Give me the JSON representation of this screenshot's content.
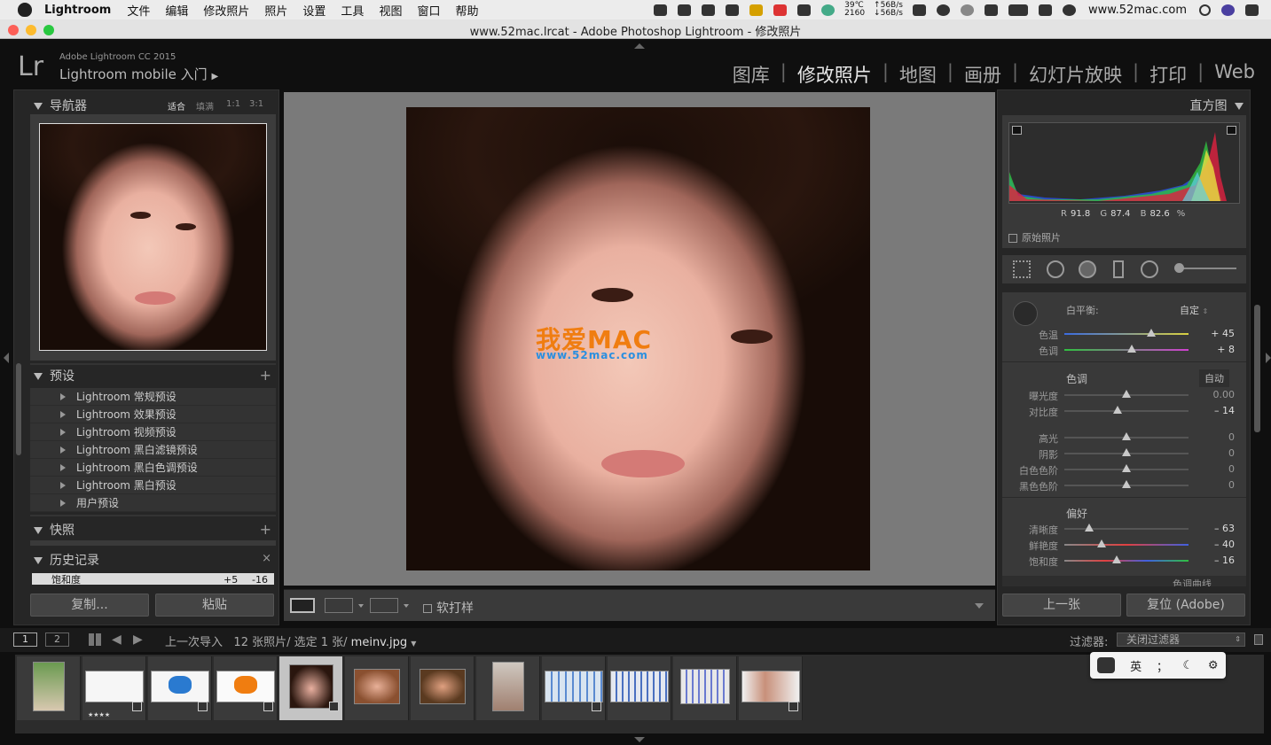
{
  "menubar": {
    "app_name": "Lightroom",
    "items": [
      "文件",
      "编辑",
      "修改照片",
      "照片",
      "设置",
      "工具",
      "视图",
      "窗口",
      "帮助"
    ],
    "temp": "39℃",
    "rpm": "2160",
    "net_up": "↑56B/s",
    "net_down": "↓56B/s",
    "site": "www.52mac.com"
  },
  "window": {
    "title": "www.52mac.lrcat - Adobe Photoshop Lightroom - 修改照片"
  },
  "identity": {
    "logo": "Lr",
    "version": "Adobe Lightroom CC 2015",
    "mobile": "Lightroom mobile 入门"
  },
  "modules": [
    {
      "label": "图库",
      "active": false
    },
    {
      "label": "修改照片",
      "active": true
    },
    {
      "label": "地图",
      "active": false
    },
    {
      "label": "画册",
      "active": false
    },
    {
      "label": "幻灯片放映",
      "active": false
    },
    {
      "label": "打印",
      "active": false
    },
    {
      "label": "Web",
      "active": false
    }
  ],
  "navigator": {
    "title": "导航器",
    "zoom_fit": "适合",
    "zoom_fill": "填满",
    "zoom_1": "1:1",
    "zoom_3": "3:1"
  },
  "presets": {
    "title": "预设",
    "items": [
      "Lightroom 常规预设",
      "Lightroom 效果预设",
      "Lightroom 视频预设",
      "Lightroom 黑白滤镜预设",
      "Lightroom 黑白色调预设",
      "Lightroom 黑白预设",
      "用户预设"
    ]
  },
  "snapshots": {
    "title": "快照"
  },
  "history": {
    "title": "历史记录",
    "entry": "饱和度",
    "from": "+5",
    "to": "-16"
  },
  "left_buttons": {
    "copy": "复制...",
    "paste": "粘贴"
  },
  "watermark": {
    "text": "我爱MAC",
    "url": "www.52mac.com"
  },
  "toolbar": {
    "soft_proof": "软打样"
  },
  "histogram": {
    "title": "直方图",
    "r_label": "R",
    "r": "91.8",
    "g_label": "G",
    "g": "87.4",
    "b_label": "B",
    "b": "82.6",
    "unit": "%",
    "original": "原始照片"
  },
  "basic": {
    "wb_label": "白平衡:",
    "wb_value": "自定",
    "tone_label": "色调",
    "auto": "自动",
    "presence_label": "偏好",
    "tone_curve": "色调曲线",
    "sliders": [
      {
        "label": "色温",
        "value": "+ 45",
        "level": 0.7
      },
      {
        "label": "色调",
        "value": "+ 8",
        "level": 0.54
      },
      {
        "label": "曝光度",
        "value": "0.00",
        "level": 0.5
      },
      {
        "label": "对比度",
        "value": "– 14",
        "level": 0.43
      },
      {
        "label": "高光",
        "value": "0",
        "level": 0.5
      },
      {
        "label": "阴影",
        "value": "0",
        "level": 0.5
      },
      {
        "label": "白色色阶",
        "value": "0",
        "level": 0.5
      },
      {
        "label": "黑色色阶",
        "value": "0",
        "level": 0.5
      },
      {
        "label": "清晰度",
        "value": "– 63",
        "level": 0.2
      },
      {
        "label": "鲜艳度",
        "value": "– 40",
        "level": 0.3
      },
      {
        "label": "饱和度",
        "value": "– 16",
        "level": 0.42
      }
    ]
  },
  "right_buttons": {
    "prev": "上一张",
    "reset": "复位 (Adobe)"
  },
  "filmbar": {
    "view1": "1",
    "view2": "2",
    "source": "上一次导入",
    "count": "12 张照片/ 选定 1 张/",
    "filename": "meinv.jpg",
    "filter_label": "过滤器:",
    "filter_value": "关闭过滤器"
  },
  "film_thumbs": [
    "meinv-1",
    "mac-logo-1",
    "apple-logo",
    "mac-logo-2",
    "meinv",
    "girl-2",
    "boy",
    "girl-3",
    "screen-1",
    "screen-2",
    "screen-3",
    "girl-4"
  ],
  "film_stars": "★★★★",
  "ime": {
    "mode": "英",
    "punct": "；"
  }
}
